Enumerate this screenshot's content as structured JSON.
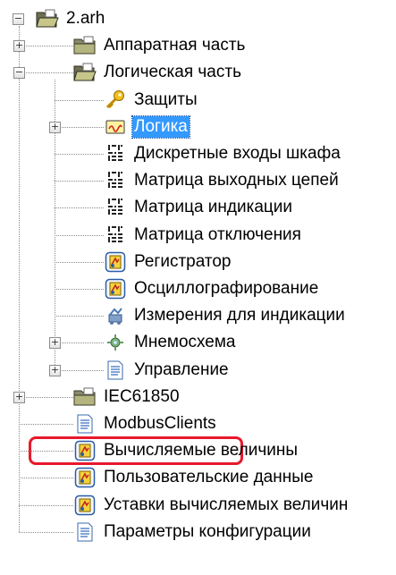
{
  "tree": {
    "root": {
      "label": "2.arh",
      "icon": "folder-open-icon",
      "expanded": true
    },
    "items": [
      {
        "label": "Аппаратная часть",
        "icon": "folder-icon",
        "level": 1,
        "toggle": "+"
      },
      {
        "label": "Логическая часть",
        "icon": "folder-open-icon",
        "level": 1,
        "toggle": "-"
      },
      {
        "label": "Защиты",
        "icon": "key-icon",
        "level": 2
      },
      {
        "label": "Логика",
        "icon": "logic-icon",
        "level": 2,
        "toggle": "+",
        "selected": true
      },
      {
        "label": "Дискретные входы шкафа",
        "icon": "matrix-icon",
        "level": 2
      },
      {
        "label": "Матрица выходных цепей",
        "icon": "matrix-icon",
        "level": 2
      },
      {
        "label": "Матрица индикации",
        "icon": "matrix-icon",
        "level": 2
      },
      {
        "label": "Матрица отключения",
        "icon": "matrix-icon",
        "level": 2
      },
      {
        "label": "Регистратор",
        "icon": "recorder-icon",
        "level": 2
      },
      {
        "label": "Осциллографирование",
        "icon": "recorder-icon",
        "level": 2
      },
      {
        "label": "Измерения для индикации",
        "icon": "measurement-icon",
        "level": 2
      },
      {
        "label": "Мнемосхема",
        "icon": "mnemonic-icon",
        "level": 2,
        "toggle": "+"
      },
      {
        "label": "Управление",
        "icon": "document-icon",
        "level": 2,
        "toggle": "+"
      },
      {
        "label": "IEC61850",
        "icon": "folder-icon",
        "level": 1,
        "toggle": "+"
      },
      {
        "label": "ModbusClients",
        "icon": "document-icon",
        "level": 1,
        "highlighted": true
      },
      {
        "label": "Вычисляемые величины",
        "icon": "recorder-icon",
        "level": 1
      },
      {
        "label": "Пользовательские данные",
        "icon": "recorder-icon",
        "level": 1
      },
      {
        "label": "Уставки вычисляемых величин",
        "icon": "recorder-icon",
        "level": 1
      },
      {
        "label": "Параметры конфигурации",
        "icon": "document-icon",
        "level": 1
      }
    ]
  },
  "colors": {
    "selection": "#3399ff",
    "highlight_border": "#e8192c",
    "tree_lines": "#8a8a8a"
  }
}
